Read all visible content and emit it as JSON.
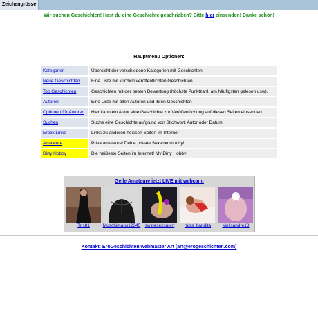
{
  "toolbar": {
    "font_size_label": "Zeichengrösse"
  },
  "notice": {
    "before": "Wir suchen Geschichten! Hast du eine Geschichte geschrieben? Bitte ",
    "link": "hier",
    "after": " einsenden! Danke schön!"
  },
  "menu": {
    "title": "Hauptmenü Optionen:",
    "rows": [
      {
        "label": "Kategorien",
        "desc": "Übersicht der verschiedene Kategorien mit Geschichten"
      },
      {
        "label": "Neue Geschichten",
        "desc": "Eine Liste mit kürzlich veröffentlichten Geschichten"
      },
      {
        "label": "Top Geschichten",
        "desc": "Geschichten mit der besten Bewertung (höchste Punktzahl, am häufigsten gelesen usw)."
      },
      {
        "label": "Autoren",
        "desc": "Eine Liste mit allen Autoren und ihren Geschichten"
      },
      {
        "label": "Optionen für Autoren",
        "desc": "Hier kann ein Autor eine Geschichte zur Veröffentlichung auf diesen Seiten einsenden"
      },
      {
        "label": "Suchen",
        "desc": "Suche eine Geschichte aufgrund von Stichwort, Autor oder Datum"
      },
      {
        "label": "Erotik Links",
        "desc": "Links zu anderen heissen Seiten im Internet"
      },
      {
        "label": "Amateure",
        "desc": "Privatamateure! Deine private Sex-community!"
      },
      {
        "label": "Dirty Hobby",
        "desc": "Die heißeste Seiten im Internet! My Dirty Hobby!"
      }
    ]
  },
  "webcams": {
    "title": "Geile Amateure jetzt LIVE mit webcam:",
    "names": [
      "Tris81",
      "Muschimaus12345",
      "swipesexsquirt",
      "miss_bandita",
      "Melisandre18"
    ]
  },
  "contact": "Kontakt: EroGeschichten webmaster Art (art@erogeschichten.com)",
  "colors": {
    "highlight": "#ffff00",
    "notice_text": "#1b8a1b",
    "link": "#0000cc",
    "topbar": "#a9c3d9"
  }
}
